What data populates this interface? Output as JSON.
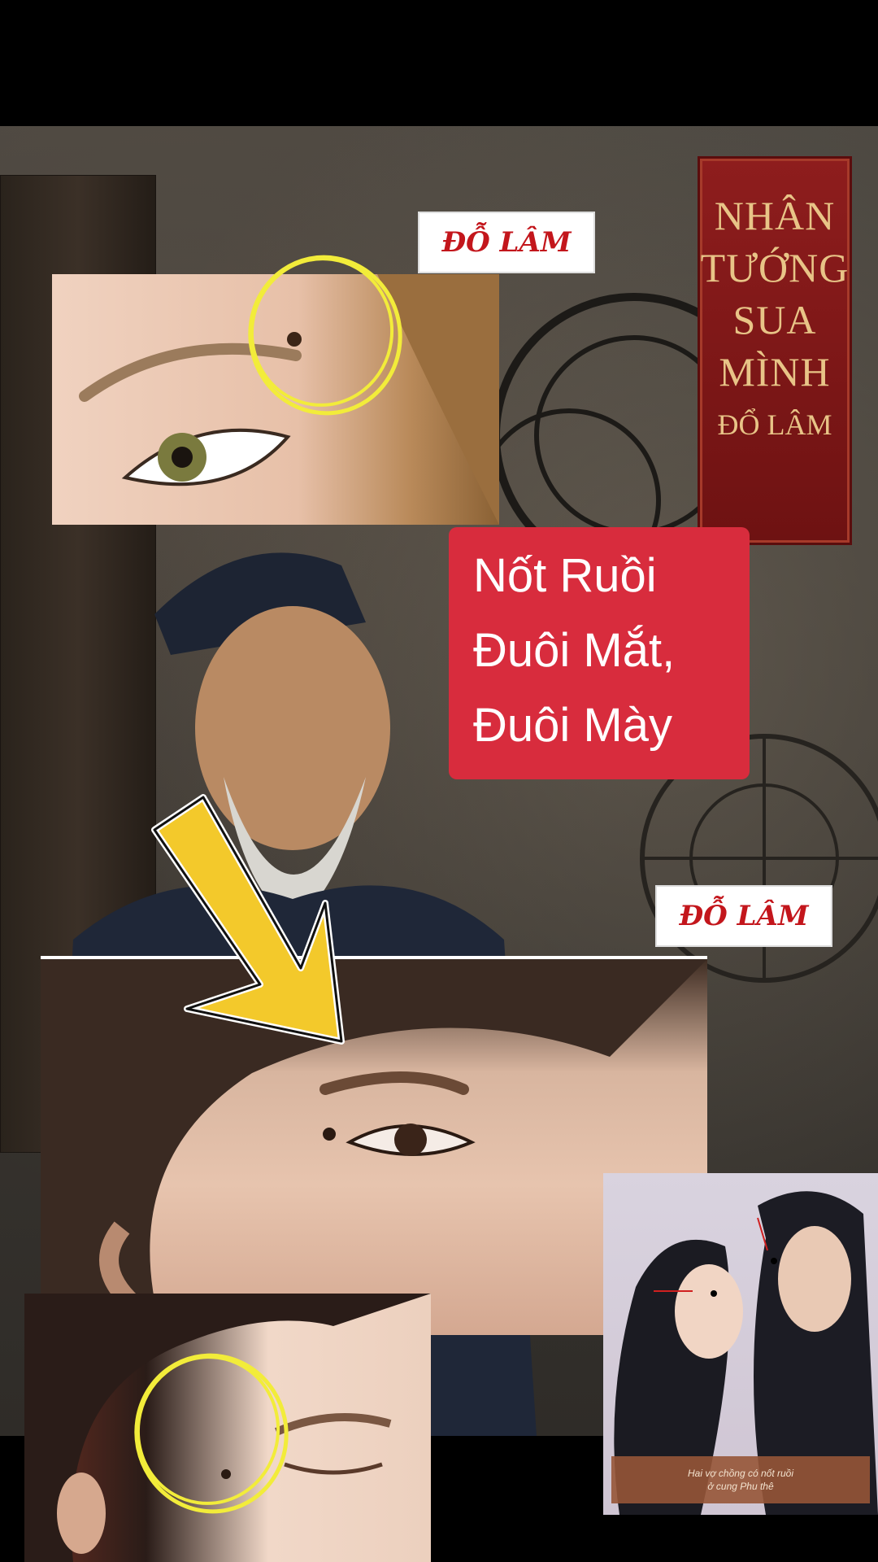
{
  "book_cover": {
    "lines": [
      "NHÂN",
      "TƯỚNG",
      "SUA",
      "MÌNH"
    ],
    "author": "ĐỔ LÂM"
  },
  "tags": {
    "top": "ĐỖ LÂM",
    "middle": "ĐỖ LÂM"
  },
  "title": {
    "lines": [
      "Nốt Ruồi",
      "Đuôi Mắt,",
      "Đuôi Mày"
    ]
  },
  "couple_caption": {
    "line1": "Hai vợ chồng có nốt ruồi",
    "line2": "ở cung Phu thê"
  },
  "colors": {
    "title_bg": "#d82c3d",
    "tag_text": "#c3161c",
    "book_bg": "#8e1d1d",
    "highlight_circle": "#f2ec3a",
    "arrow": "#f3c92b"
  }
}
